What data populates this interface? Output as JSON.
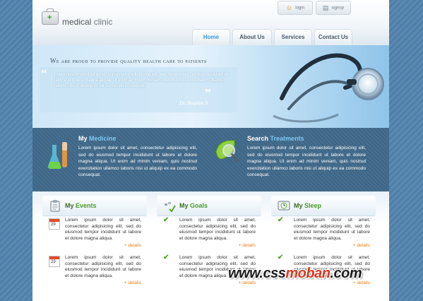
{
  "header": {
    "logo_word1": "medical",
    "logo_word2": "clinic",
    "login_label": "login",
    "signup_label": "signup",
    "nav": [
      "Home",
      "About Us",
      "Services",
      "Contact Us"
    ],
    "active_nav": "Home"
  },
  "hero": {
    "title": "We are proud to provide quality health care to patients",
    "text": "Lorem ipsum dolor sit amet, consectetur adipisicing elit, sed do eiusmod tempor incididunt ut labore et dolore magna aliqua. Ut enim ad minim veniam, quis nostrud exercitation ullamco laboris nisi ut aliquip ex ea commodo consequat.",
    "signature": "Dr. Bogdan S"
  },
  "features": [
    {
      "title_prefix": "My",
      "title_accent": "Medicine",
      "text": "Lorem ipsum dolor sit amet, consectetur adipisicing elit, sed do eiusmod tempor incididunt ut labore et dolore magna aliqua. Ut enim ad minim veniam, quis nostrud exercitation ullamco laboris nisi ut aliquip ex ea commodo consequat."
    },
    {
      "title_prefix": "Search",
      "title_accent": "Treatments",
      "text": "Lorem ipsum dolor sit amet, consectetur adipisicing elit, sed do eiusmod tempor incididunt ut labore et dolore magna aliqua. Ut enim ad minim veniam, quis nostrud exercitation ullamco laboris nisi ut aliquip ex ea commodo consequat."
    }
  ],
  "columns": [
    {
      "title_prefix": "My",
      "title_accent": "Events",
      "entries": [
        {
          "day": "29",
          "text": "Lorem ipsum dolor sit amet, consectetur adipisicing elit, sed do eiusmod tempor incididunt ut labore et dolore magna aliqua.",
          "more": "+ details"
        },
        {
          "day": "29",
          "text": "Lorem ipsum dolor sit amet, consectetur adipisicing elit, sed do eiusmod tempor incididunt ut labore et dolore magna aliqua.",
          "more": "+ details"
        }
      ]
    },
    {
      "title_prefix": "My",
      "title_accent": "Goals",
      "entries": [
        {
          "text": "Lorem ipsum dolor sit amet, consectetur adipisicing elit, sed do eiusmod tempor incididunt ut labore et dolore magna aliqua.",
          "more": "+ details"
        },
        {
          "text": "Lorem ipsum dolor sit amet, consectetur adipisicing elit, sed do eiusmod tempor incididunt ut labore et dolore magna aliqua.",
          "more": "+ details"
        }
      ]
    },
    {
      "title_prefix": "My",
      "title_accent": "Sleep",
      "entries": [
        {
          "text": "Lorem ipsum dolor sit amet, consectetur adipisicing elit, sed do eiusmod tempor incididunt ut labore et dolore magna aliqua.",
          "more": "+ details"
        },
        {
          "text": "Lorem ipsum dolor sit amet, consectetur adipisicing elit, sed do eiusmod tempor incididunt ut labore et dolore magna aliqua.",
          "more": "+ details"
        }
      ]
    }
  ],
  "watermark": {
    "part1": "www.css",
    "part2": "moban",
    "part3": ".com"
  },
  "colors": {
    "accent_blue": "#3d98d6",
    "accent_green": "#4a9b2b",
    "details_orange": "#f07d13",
    "band": "#446a8a"
  }
}
